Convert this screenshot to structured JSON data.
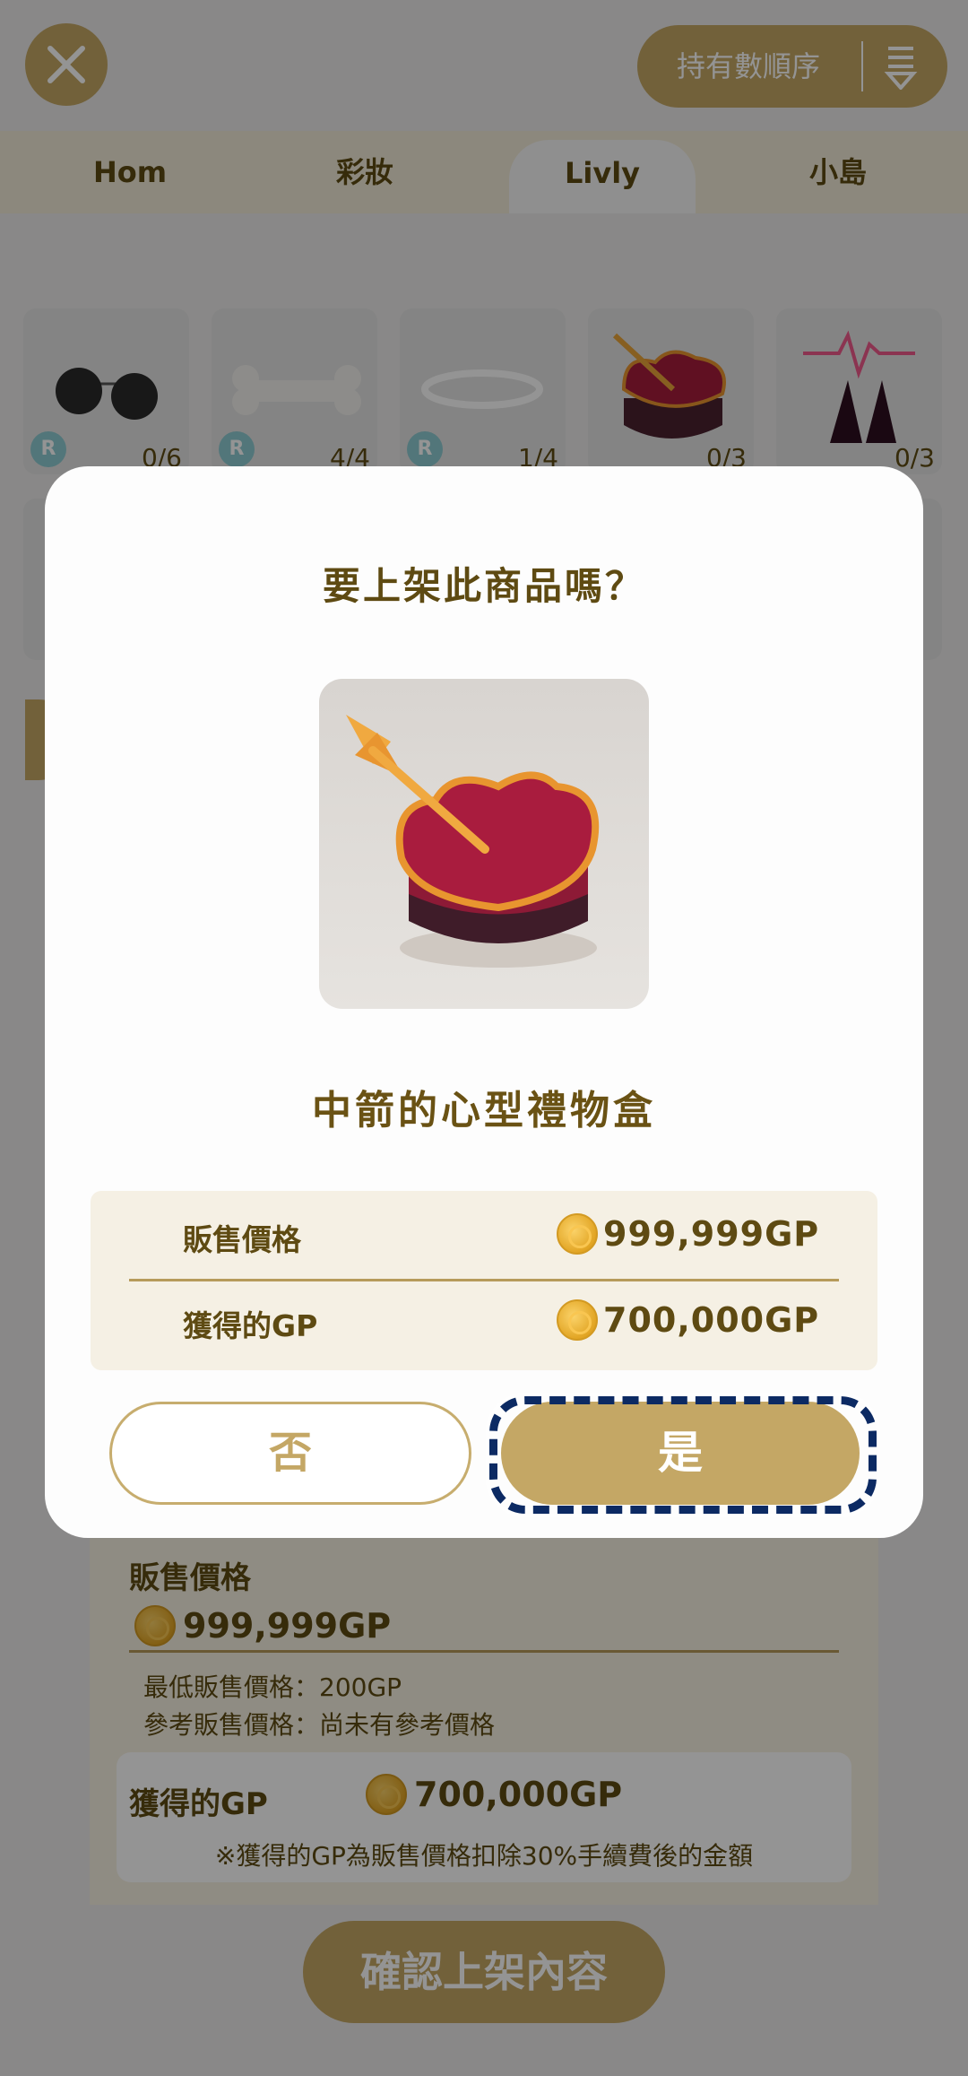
{
  "header": {
    "sort_label": "持有數順序",
    "close_icon": "close-icon",
    "sort_icon": "sort-icon"
  },
  "tabs": [
    {
      "label": "Hom",
      "active": false
    },
    {
      "label": "彩妝",
      "active": false
    },
    {
      "label": "Livly",
      "active": true
    },
    {
      "label": "小島",
      "active": false
    }
  ],
  "items": [
    {
      "name": "sunglasses-icon",
      "rarity": "R",
      "count": "0/6"
    },
    {
      "name": "bone-icon",
      "rarity": "R",
      "count": "4/4"
    },
    {
      "name": "halo-icon",
      "rarity": "R",
      "count": "1/4"
    },
    {
      "name": "heart-gift-box-icon",
      "rarity": "",
      "count": "0/3"
    },
    {
      "name": "neon-horns-icon",
      "rarity": "",
      "count": "0/3"
    }
  ],
  "background_form": {
    "sale_price_label": "販售價格",
    "sale_price_value": "999,999GP",
    "min_price_note": "最低販售價格：200GP",
    "ref_price_note": "參考販售價格：尚未有參考價格",
    "gp_label": "獲得的GP",
    "gp_value": "700,000GP",
    "gp_note": "※獲得的GP為販售價格扣除30%手續費後的金額",
    "confirm_label": "確認上架內容"
  },
  "dialog": {
    "title": "要上架此商品嗎？",
    "item_name": "中箭的心型禮物盒",
    "price_label": "販售價格",
    "price_value": "999,999GP",
    "gp_label": "獲得的GP",
    "gp_value": "700,000GP",
    "no_label": "否",
    "yes_label": "是"
  },
  "colors": {
    "accent": "#c4a765",
    "text": "#5e4a12",
    "focus_ring": "#0c2a63"
  }
}
